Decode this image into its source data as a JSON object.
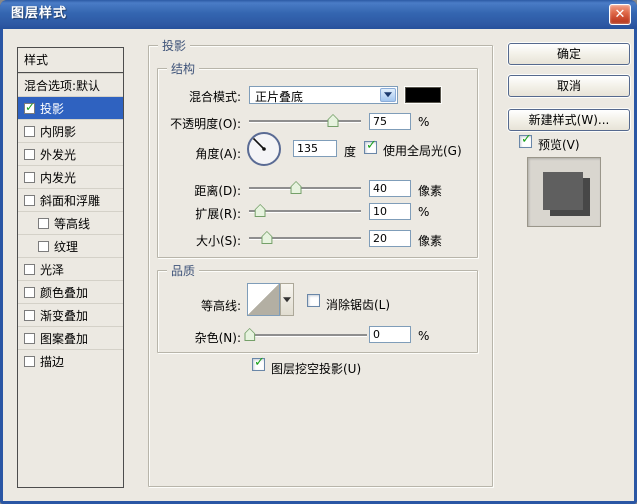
{
  "window": {
    "title": "图层样式"
  },
  "icons": {
    "check": "✓",
    "close": "✕"
  },
  "sidebar": {
    "header": "样式",
    "items": [
      {
        "label": "混合选项:默认"
      },
      {
        "label": "投影"
      },
      {
        "label": "内阴影"
      },
      {
        "label": "外发光"
      },
      {
        "label": "内发光"
      },
      {
        "label": "斜面和浮雕"
      },
      {
        "label": "等高线"
      },
      {
        "label": "纹理"
      },
      {
        "label": "光泽"
      },
      {
        "label": "颜色叠加"
      },
      {
        "label": "渐变叠加"
      },
      {
        "label": "图案叠加"
      },
      {
        "label": "描边"
      }
    ]
  },
  "panel": {
    "legend": "投影",
    "structure": {
      "legend": "结构",
      "blend_mode": {
        "label": "混合模式:",
        "value": "正片叠底",
        "swatch_color": "#000000"
      },
      "opacity": {
        "label": "不透明度(O):",
        "value": "75",
        "unit": "%",
        "fraction": 0.75
      },
      "angle": {
        "label": "角度(A):",
        "value": "135",
        "unit": "度",
        "global_light_label": "使用全局光(G)"
      },
      "distance": {
        "label": "距离(D):",
        "value": "40",
        "unit": "像素",
        "fraction": 0.42
      },
      "spread": {
        "label": "扩展(R):",
        "value": "10",
        "unit": "%",
        "fraction": 0.1
      },
      "size": {
        "label": "大小(S):",
        "value": "20",
        "unit": "像素",
        "fraction": 0.16
      }
    },
    "quality": {
      "legend": "品质",
      "contour": {
        "label": "等高线:",
        "anti_alias_label": "消除锯齿(L)"
      },
      "noise": {
        "label": "杂色(N):",
        "value": "0",
        "unit": "%",
        "fraction": 0.03
      },
      "knockout_label": "图层挖空投影(U)"
    }
  },
  "actions": {
    "ok": "确定",
    "cancel": "取消",
    "new_style": "新建样式(W)...",
    "preview": "预览(V)"
  }
}
